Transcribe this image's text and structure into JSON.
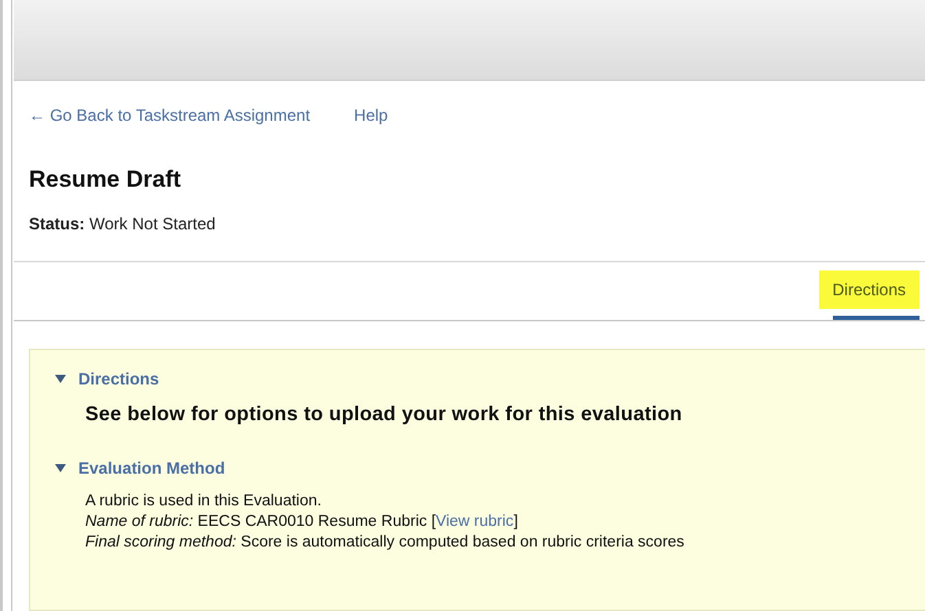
{
  "nav_links": [
    {
      "label": "← Go Back to Taskstream Assignment"
    },
    {
      "label": "Help"
    }
  ],
  "title": "Resume Draft",
  "status": {
    "label": "Status:",
    "value": "Work Not Started"
  },
  "tabs": [
    {
      "label": "Directions",
      "selected": true,
      "highlighted": true
    }
  ],
  "sections": [
    {
      "title": "Directions",
      "expanded": true,
      "kind": "heading",
      "text": "See below for options to upload your work for this evaluation"
    },
    {
      "title": "Evaluation Method",
      "expanded": true,
      "kind": "details",
      "lines": [
        {
          "text": "A rubric is used in this Evaluation."
        },
        {
          "text": "*Name of rubric:* EECS CAR0010 Resume Rubric [",
          "link": "View rubric",
          "suffix": "]"
        },
        {
          "text": "*Final scoring method:* Score is automatically computed based on rubric criteria scores"
        }
      ]
    }
  ]
}
